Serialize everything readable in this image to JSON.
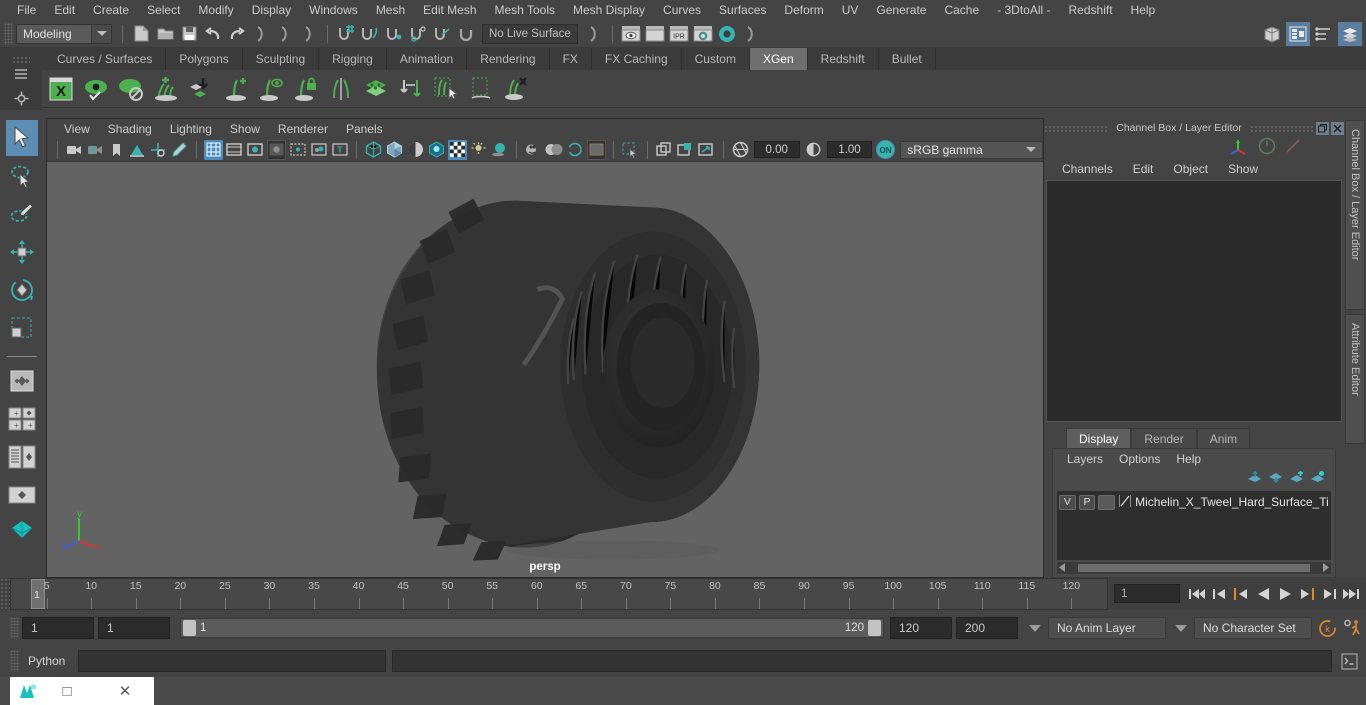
{
  "menubar": {
    "items": [
      "File",
      "Edit",
      "Create",
      "Select",
      "Modify",
      "Display",
      "Windows",
      "Mesh",
      "Edit Mesh",
      "Mesh Tools",
      "Mesh Display",
      "Curves",
      "Surfaces",
      "Deform",
      "UV",
      "Generate",
      "Cache",
      "- 3DtoAll -",
      "Redshift",
      "Help"
    ]
  },
  "statusline": {
    "mode": "Modeling",
    "live_surface": "No Live Surface",
    "icons": [
      "new-scene-icon",
      "open-scene-icon",
      "save-scene-icon",
      "undo-icon",
      "redo-icon",
      "select-hierarchy-icon",
      "select-object-icon",
      "select-component-icon",
      "snap-grid-icon",
      "snap-curve-icon",
      "snap-point-icon",
      "snap-projected-center-icon",
      "snap-view-plane-icon",
      "make-live-icon",
      "render-view-icon",
      "render-frame-icon",
      "ipr-render-icon",
      "render-settings-icon",
      "hypershade-icon"
    ],
    "panel_buttons": [
      "show-hide-modeling-toolkit-icon",
      "show-hide-attribute-editor-icon",
      "show-hide-tool-settings-icon",
      "show-hide-channel-box-icon"
    ]
  },
  "shelf": {
    "tabs": [
      "Curves / Surfaces",
      "Polygons",
      "Sculpting",
      "Rigging",
      "Animation",
      "Rendering",
      "FX",
      "FX Caching",
      "Custom",
      "XGen",
      "Redshift",
      "Bullet"
    ],
    "active_tab": "XGen",
    "icons": [
      "xgen-editor-icon",
      "xgen-preview-toggle-icon",
      "xgen-preview-off-icon",
      "xgen-add-description-icon",
      "xgen-import-collection-icon",
      "xgen-add-guide-icon",
      "xgen-guide-visibility-icon",
      "xgen-lock-guide-icon",
      "xgen-mirror-guide-icon",
      "xgen-layers-icon",
      "xgen-convert-icon",
      "xgen-select-guides-icon",
      "xgen-marquee-select-icon",
      "xgen-delete-guides-icon"
    ]
  },
  "toolbox": {
    "tools": [
      "select-tool",
      "lasso-select-tool",
      "paint-select-tool",
      "move-tool",
      "rotate-tool",
      "scale-tool",
      "last-tool-used",
      "quick-layout-single-icon",
      "quick-layout-four-view-icon",
      "quick-layout-outliner-icon",
      "quick-layout-persp-icon",
      "quick-layout-hypershade-icon"
    ],
    "selected": "select-tool"
  },
  "viewport": {
    "menus": [
      "View",
      "Shading",
      "Lighting",
      "Show",
      "Renderer",
      "Panels"
    ],
    "toolbar_icons": [
      "select-camera-icon",
      "camera-attributes-icon",
      "bookmark-icon",
      "image-plane-icon",
      "two-d-pan-zoom-icon",
      "grease-pencil-icon",
      "grid-toggle-icon",
      "film-gate-icon",
      "resolution-gate-icon",
      "gate-mask-icon",
      "film-origin-icon",
      "safe-action-icon",
      "safe-title-icon",
      "wireframe-icon",
      "smooth-shade-icon",
      "shaded-wireframe-icon",
      "hardware-texturing-icon",
      "use-default-lighting-icon",
      "shadows-icon",
      "screen-space-ao-icon",
      "motion-blur-icon",
      "multisample-icon",
      "isolate-select-icon",
      "xray-icon",
      "xray-joints-icon",
      "xray-active-components-icon",
      "exposure-reset-icon"
    ],
    "exposure": "0.00",
    "gamma": "1.00",
    "view_transform": "sRGB gamma",
    "camera_label": "persp",
    "axis": {
      "x": "x",
      "y": "y",
      "z": "z"
    }
  },
  "right_panel": {
    "title": "Channel Box / Layer Editor",
    "channel_menus": [
      "Channels",
      "Edit",
      "Object",
      "Show"
    ],
    "layer_tabs": [
      "Display",
      "Render",
      "Anim"
    ],
    "active_layer_tab": "Display",
    "layer_menus": [
      "Layers",
      "Options",
      "Help"
    ],
    "layers": [
      {
        "visibility": "V",
        "playback": "P",
        "name": "Michelin_X_Tweel_Hard_Surface_Tire_"
      }
    ],
    "vertical_tabs": [
      "Channel Box / Layer Editor",
      "Attribute Editor"
    ]
  },
  "timeline": {
    "ticks": [
      5,
      10,
      15,
      20,
      25,
      30,
      35,
      40,
      45,
      50,
      55,
      60,
      65,
      70,
      75,
      80,
      85,
      90,
      95,
      100,
      105,
      110,
      115,
      120
    ],
    "start": 1,
    "end": 120,
    "current_frame": "1",
    "current_frame_field": "1",
    "playback_buttons": [
      "go-to-start-icon",
      "step-back-keyframe-icon",
      "step-back-frame-icon",
      "play-backwards-icon",
      "play-forwards-icon",
      "step-forward-frame-icon",
      "step-forward-keyframe-icon",
      "go-to-end-icon"
    ]
  },
  "range": {
    "anim_start": "1",
    "range_start": "1",
    "slider_start": "1",
    "slider_end": "120",
    "range_end": "120",
    "anim_end": "200",
    "anim_layer": "No Anim Layer",
    "character_set": "No Character Set",
    "buttons": [
      "auto-keyframe-icon",
      "animation-preferences-icon"
    ]
  },
  "command_line": {
    "language": "Python",
    "input_value": "",
    "output_value": "",
    "script_editor_button": "script-editor-icon"
  },
  "taskbar": {
    "window_icon": "maya-app-icon",
    "restore_label": "□",
    "close_label": "✕"
  },
  "colors": {
    "accent_blue": "#4b8bbd",
    "accent_teal": "#36b3b3",
    "shelf_green": "#4caf50",
    "panel_bg": "#444444",
    "viewport_bg": "#636363",
    "orange": "#e08a2e"
  }
}
